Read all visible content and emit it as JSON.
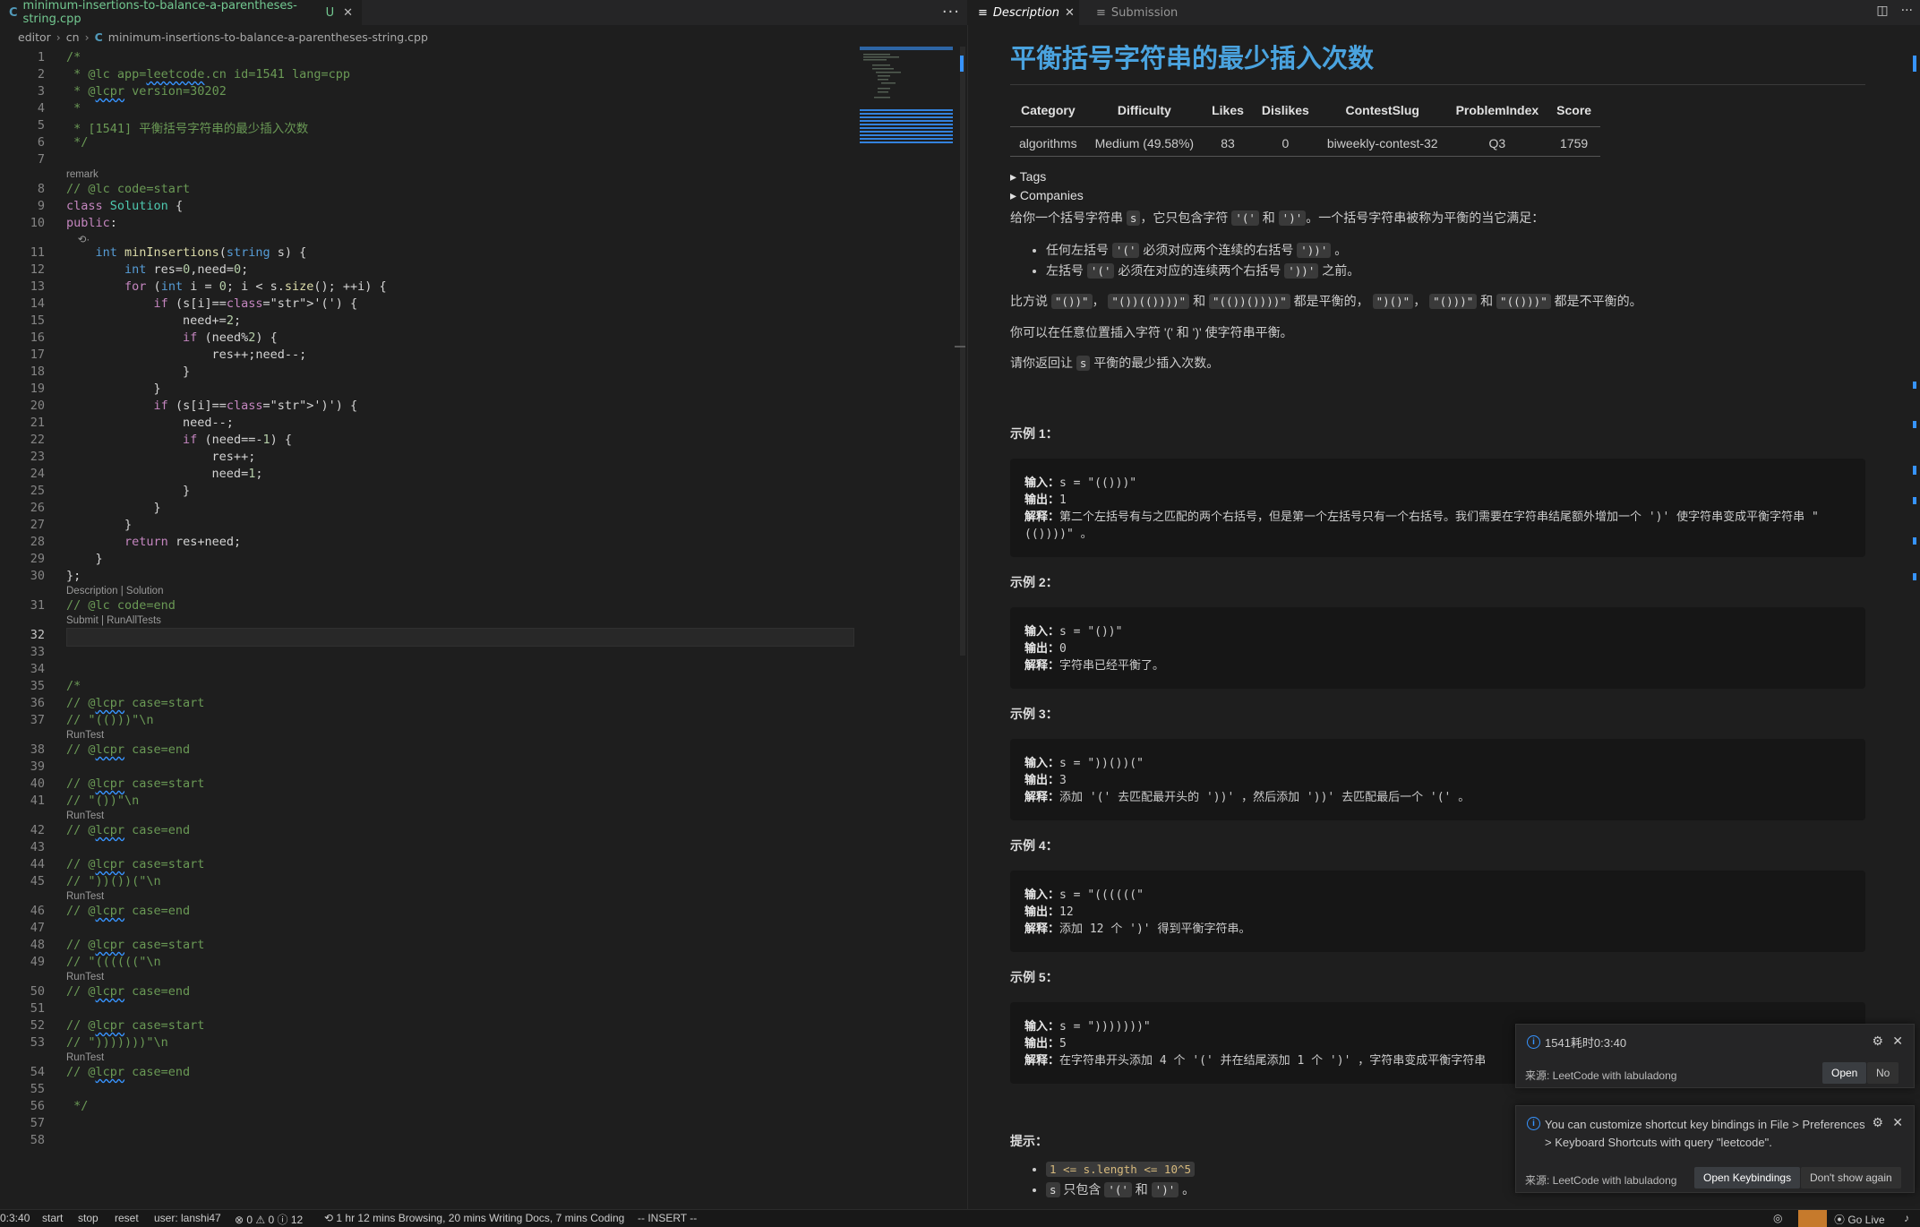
{
  "editor": {
    "tab": {
      "file": "minimum-insertions-to-balance-a-parentheses-string.cpp",
      "status": "U"
    },
    "breadcrumb": [
      "editor",
      "cn",
      "minimum-insertions-to-balance-a-parentheses-string.cpp"
    ],
    "lines": [
      {
        "n": "1",
        "t": "/*"
      },
      {
        "n": "2",
        "t": " * @lc app=leetcode.cn id=1541 lang=cpp"
      },
      {
        "n": "3",
        "t": " * @lcpr version=30202"
      },
      {
        "n": "4",
        "t": " *"
      },
      {
        "n": "5",
        "t": " * [1541] 平衡括号字符串的最少插入次数"
      },
      {
        "n": "6",
        "t": " */"
      },
      {
        "n": "7",
        "t": ""
      },
      {
        "n": "",
        "t": "remark",
        "lens": true
      },
      {
        "n": "8",
        "t": "// @lc code=start"
      },
      {
        "n": "9",
        "t": "class Solution {"
      },
      {
        "n": "10",
        "t": "public:"
      },
      {
        "n": "",
        "t": "    ⟲·",
        "lens": true
      },
      {
        "n": "11",
        "t": "    int minInsertions(string s) {"
      },
      {
        "n": "12",
        "t": "        int res=0,need=0;"
      },
      {
        "n": "13",
        "t": "        for (int i = 0; i < s.size(); ++i) {"
      },
      {
        "n": "14",
        "t": "            if (s[i]=='(') {"
      },
      {
        "n": "15",
        "t": "                need+=2;"
      },
      {
        "n": "16",
        "t": "                if (need%2) {"
      },
      {
        "n": "17",
        "t": "                    res++;need--;"
      },
      {
        "n": "18",
        "t": "                }"
      },
      {
        "n": "19",
        "t": "            }"
      },
      {
        "n": "20",
        "t": "            if (s[i]==')') {"
      },
      {
        "n": "21",
        "t": "                need--;"
      },
      {
        "n": "22",
        "t": "                if (need==-1) {"
      },
      {
        "n": "23",
        "t": "                    res++;"
      },
      {
        "n": "24",
        "t": "                    need=1;"
      },
      {
        "n": "25",
        "t": "                }"
      },
      {
        "n": "26",
        "t": "            }"
      },
      {
        "n": "27",
        "t": "        }"
      },
      {
        "n": "28",
        "t": "        return res+need;"
      },
      {
        "n": "29",
        "t": "    }"
      },
      {
        "n": "30",
        "t": "};"
      },
      {
        "n": "",
        "t": "Description | Solution",
        "lens": true
      },
      {
        "n": "31",
        "t": "// @lc code=end"
      },
      {
        "n": "",
        "t": "Submit | RunAllTests",
        "lens": true
      },
      {
        "n": "32",
        "t": "",
        "current": true
      },
      {
        "n": "33",
        "t": ""
      },
      {
        "n": "34",
        "t": ""
      },
      {
        "n": "35",
        "t": "/*"
      },
      {
        "n": "36",
        "t": "// @lcpr case=start"
      },
      {
        "n": "37",
        "t": "// \"(()))\"\\n"
      },
      {
        "n": "",
        "t": "RunTest",
        "lens": true
      },
      {
        "n": "38",
        "t": "// @lcpr case=end"
      },
      {
        "n": "39",
        "t": ""
      },
      {
        "n": "40",
        "t": "// @lcpr case=start"
      },
      {
        "n": "41",
        "t": "// \"())\"\\n"
      },
      {
        "n": "",
        "t": "RunTest",
        "lens": true
      },
      {
        "n": "42",
        "t": "// @lcpr case=end"
      },
      {
        "n": "43",
        "t": ""
      },
      {
        "n": "44",
        "t": "// @lcpr case=start"
      },
      {
        "n": "45",
        "t": "// \"))())(\"\\n"
      },
      {
        "n": "",
        "t": "RunTest",
        "lens": true
      },
      {
        "n": "46",
        "t": "// @lcpr case=end"
      },
      {
        "n": "47",
        "t": ""
      },
      {
        "n": "48",
        "t": "// @lcpr case=start"
      },
      {
        "n": "49",
        "t": "// \"((((((\"\\n"
      },
      {
        "n": "",
        "t": "RunTest",
        "lens": true
      },
      {
        "n": "50",
        "t": "// @lcpr case=end"
      },
      {
        "n": "51",
        "t": ""
      },
      {
        "n": "52",
        "t": "// @lcpr case=start"
      },
      {
        "n": "53",
        "t": "// \")))))))\"\\n"
      },
      {
        "n": "",
        "t": "RunTest",
        "lens": true
      },
      {
        "n": "54",
        "t": "// @lcpr case=end"
      },
      {
        "n": "55",
        "t": ""
      },
      {
        "n": "56",
        "t": " */"
      },
      {
        "n": "57",
        "t": ""
      },
      {
        "n": "58",
        "t": ""
      }
    ]
  },
  "right": {
    "tabs": {
      "active": "Description",
      "inactive": "Submission"
    },
    "title": "平衡括号字符串的最少插入次数",
    "table": {
      "headers": [
        "Category",
        "Difficulty",
        "Likes",
        "Dislikes",
        "ContestSlug",
        "ProblemIndex",
        "Score"
      ],
      "row": [
        "algorithms",
        "Medium (49.58%)",
        "83",
        "0",
        "biweekly-contest-32",
        "Q3",
        "1759"
      ]
    },
    "details": [
      "Tags",
      "Companies"
    ],
    "intro": {
      "a": "给你一个括号字符串 ",
      "s": "s",
      "b": "，它只包含字符 ",
      "c1": "'('",
      "and": " 和 ",
      "c2": "')'",
      "c": "。一个括号字符串被称为平衡的当它满足："
    },
    "rules": [
      {
        "a": "任何左括号 ",
        "code": "'('",
        "b": " 必须对应两个连续的右括号 ",
        "code2": "'))'",
        "c": " 。"
      },
      {
        "a": "左括号 ",
        "code": "'('",
        "b": " 必须在对应的连续两个右括号 ",
        "code2": "'))'",
        "c": " 之前。"
      }
    ],
    "balanced_line": {
      "a": "比方说 ",
      "e1": "\"())\"",
      "s1": "， ",
      "e2": "\"())(())))\"",
      "s2": " 和 ",
      "e3": "\"(())())))\"",
      "b": " 都是平衡的， ",
      "e4": "\")()\"",
      "s3": "， ",
      "e5": "\"()))\"",
      "s4": " 和 ",
      "e6": "\"(()))\"",
      "c": " 都是不平衡的。"
    },
    "insert_line": "你可以在任意位置插入字符 '(' 和 ')' 使字符串平衡。",
    "return_line": {
      "a": "请你返回让 ",
      "s": "s",
      "b": " 平衡的最少插入次数。"
    },
    "examples": [
      {
        "h": "示例 1：",
        "in": "s = \"(()))\"",
        "out": "1",
        "exp": "第二个左括号有与之匹配的两个右括号，但是第一个左括号只有一个右括号。我们需要在字符串结尾额外增加一个 ')' 使字符串变成平衡字符串 \"(())))\" 。"
      },
      {
        "h": "示例 2：",
        "in": "s = \"())\"",
        "out": "0",
        "exp": "字符串已经平衡了。"
      },
      {
        "h": "示例 3：",
        "in": "s = \"))())(\"",
        "out": "3",
        "exp": "添加 '(' 去匹配最开头的 '))' ，然后添加 '))' 去匹配最后一个 '(' 。"
      },
      {
        "h": "示例 4：",
        "in": "s = \"((((((\"",
        "out": "12",
        "exp": "添加 12 个 ')' 得到平衡字符串。"
      },
      {
        "h": "示例 5：",
        "in": "s = \")))))))\"",
        "out": "5",
        "exp": "在字符串开头添加 4 个 '(' 并在结尾添加 1 个 ')' ，字符串变成平衡字符串"
      }
    ],
    "labels": {
      "in": "输入：",
      "out": "输出：",
      "exp": "解释："
    },
    "hint_h": "提示：",
    "hints": [
      {
        "code": "1 <= s.length <= 10^5"
      },
      {
        "code": "s",
        "a": " 只包含 ",
        "c1": "'('",
        "and": " 和 ",
        "c2": "')'",
        "b": " 。"
      }
    ]
  },
  "notifications": [
    {
      "msg": "1541耗时0:3:40",
      "source": "来源: LeetCode with labuladong",
      "buttons": [
        "Open",
        "No"
      ]
    },
    {
      "msg": "You can customize shortcut key bindings in File > Preferences > Keyboard Shortcuts with query \"leetcode\".",
      "source": "来源: LeetCode with labuladong",
      "buttons": [
        "Open Keybindings",
        "Don't show again"
      ]
    }
  ],
  "status": {
    "timer": "0:3:40",
    "start": "start",
    "stop": "stop",
    "reset": "reset",
    "user": "user: lanshi47",
    "problems": "⊗ 0 ⚠ 0 ⓘ 12",
    "activity": "⟲ 1 hr 12 mins Browsing, 20 mins Writing Docs, 7 mins Coding",
    "mode": "-- INSERT --",
    "golive": "⦿ Go Live"
  },
  "colors": {
    "accent": "#3794ff",
    "title": "#4aa3df",
    "copilot": "#c67a2c"
  }
}
